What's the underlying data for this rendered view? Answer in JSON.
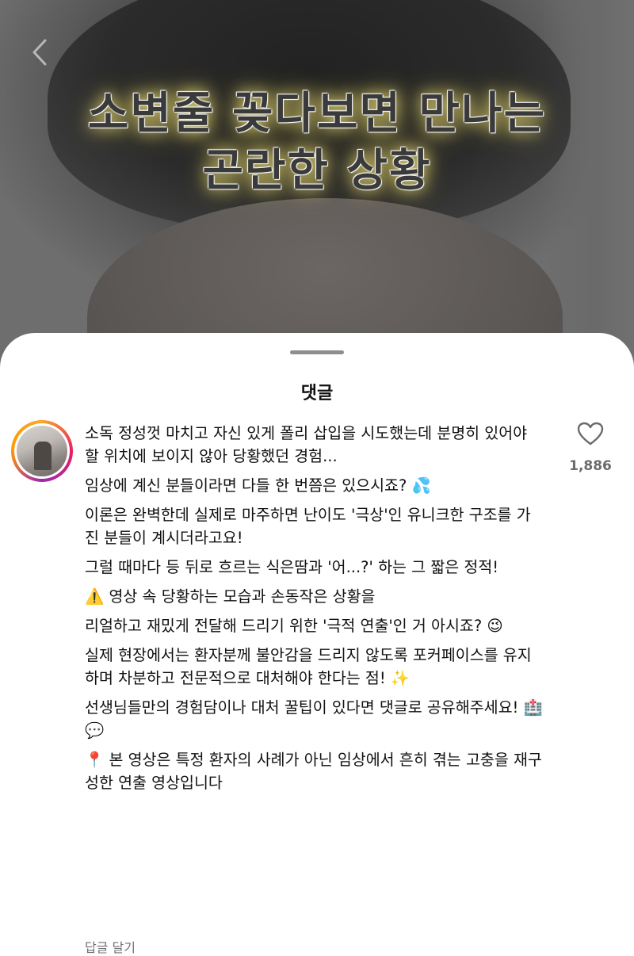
{
  "video": {
    "overlay_title_line1": "소변줄 꽂다보면 만나는",
    "overlay_title_line2": "곤란한 상황",
    "back_icon": "chevron-left-icon"
  },
  "sheet": {
    "title": "댓글"
  },
  "comment": {
    "avatar_ring_colors": [
      "#f9a825",
      "#e91e63",
      "#9c27b0"
    ],
    "paragraphs": [
      "소독 정성껏 마치고 자신 있게 폴리 삽입을 시도했는데 분명히 있어야 할 위치에 보이지 않아 당황했던 경험...",
      "임상에 계신 분들이라면 다들 한 번쯤은 있으시죠? 💦",
      "이론은 완벽한데 실제로 마주하면 난이도 '극상'인 유니크한 구조를 가진 분들이 계시더라고요!",
      "그럴 때마다 등 뒤로 흐르는 식은땀과 '어...?' 하는 그 짧은 정적!",
      "⚠️ 영상 속 당황하는 모습과 손동작은 상황을",
      "리얼하고 재밌게 전달해 드리기 위한 '극적 연출'인 거 아시죠? 😉",
      "실제 현장에서는 환자분께 불안감을 드리지 않도록 포커페이스를 유지하며 차분하고 전문적으로 대처해야 한다는 점! ✨",
      "선생님들만의 경험담이나 대처 꿀팁이 있다면 댓글로 공유해주세요! 🏥💬",
      "📍 본 영상은 특정 환자의 사례가 아닌 임상에서 흔히 겪는 고충을 재구성한 연출 영상입니다"
    ],
    "like_icon": "heart-outline-icon",
    "like_count": "1,886",
    "reply_label": "답글 달기"
  }
}
